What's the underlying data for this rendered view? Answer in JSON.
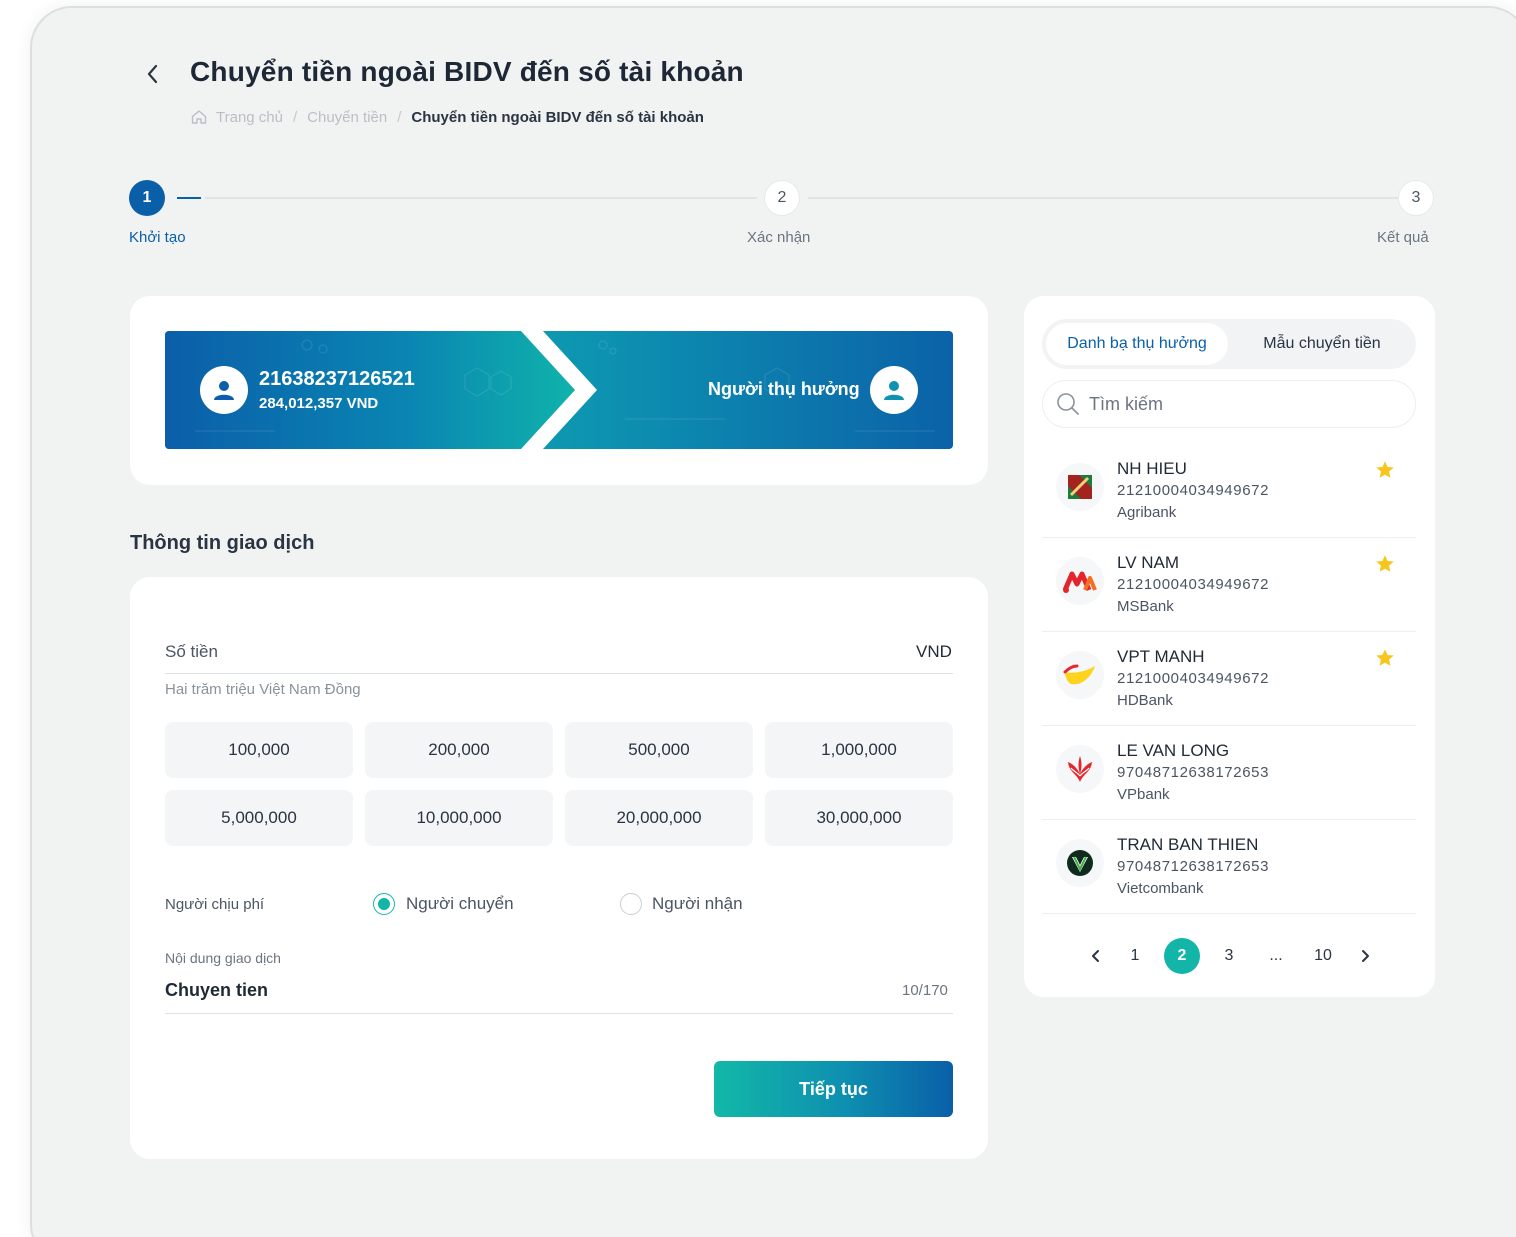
{
  "header": {
    "title": "Chuyển tiền ngoài BIDV đến số tài khoản",
    "breadcrumb": [
      "Trang chủ",
      "Chuyển tiền",
      "Chuyển tiền ngoài BIDV đến số tài khoản"
    ]
  },
  "stepper": {
    "steps": [
      {
        "number": "1",
        "label": "Khởi tạo"
      },
      {
        "number": "2",
        "label": "Xác nhận"
      },
      {
        "number": "3",
        "label": "Kết quả"
      }
    ],
    "current": 1
  },
  "source_account": {
    "number": "21638237126521",
    "balance": "284,012,357 VND"
  },
  "beneficiary_placeholder": "Người thụ hưởng",
  "transaction": {
    "section_title": "Thông tin giao dịch",
    "amount_label": "Số tiền",
    "currency": "VND",
    "amount_in_words": "Hai trăm triệu Việt Nam Đồng",
    "quick_amounts": [
      "100,000",
      "200,000",
      "500,000",
      "1,000,000",
      "5,000,000",
      "10,000,000",
      "20,000,000",
      "30,000,000"
    ],
    "fee_label": "Người chịu phí",
    "fee_options": [
      "Người chuyển",
      "Người nhận"
    ],
    "fee_selected": "Người chuyển",
    "content_label": "Nội dung giao dịch",
    "content_value": "Chuyen tien",
    "content_counter": "10/170",
    "submit_label": "Tiếp tục"
  },
  "sidebar": {
    "tabs": [
      "Danh bạ thụ hưởng",
      "Mẫu chuyển tiền"
    ],
    "active_tab": "Danh bạ thụ hưởng",
    "search_placeholder": "Tìm kiếm",
    "contacts": [
      {
        "name": "NH HIEU",
        "account": "21210004034949672",
        "bank": "Agribank",
        "favorite": true,
        "logo": "agribank-logo"
      },
      {
        "name": "LV NAM",
        "account": "21210004034949672",
        "bank": "MSBank",
        "favorite": true,
        "logo": "msb-logo"
      },
      {
        "name": "VPT MANH",
        "account": "21210004034949672",
        "bank": "HDBank",
        "favorite": true,
        "logo": "hdbank-logo"
      },
      {
        "name": "LE VAN LONG",
        "account": "97048712638172653",
        "bank": "VPbank",
        "favorite": false,
        "logo": "vpbank-logo"
      },
      {
        "name": "TRAN BAN THIEN",
        "account": "97048712638172653",
        "bank": "Vietcombank",
        "favorite": false,
        "logo": "vietcombank-logo"
      }
    ],
    "pagination": {
      "pages": [
        "1",
        "2",
        "3",
        "...",
        "10"
      ],
      "current": "2"
    }
  },
  "colors": {
    "primary": "#0a5fa8",
    "accent": "#12b5a7",
    "star": "#f7c51c"
  }
}
